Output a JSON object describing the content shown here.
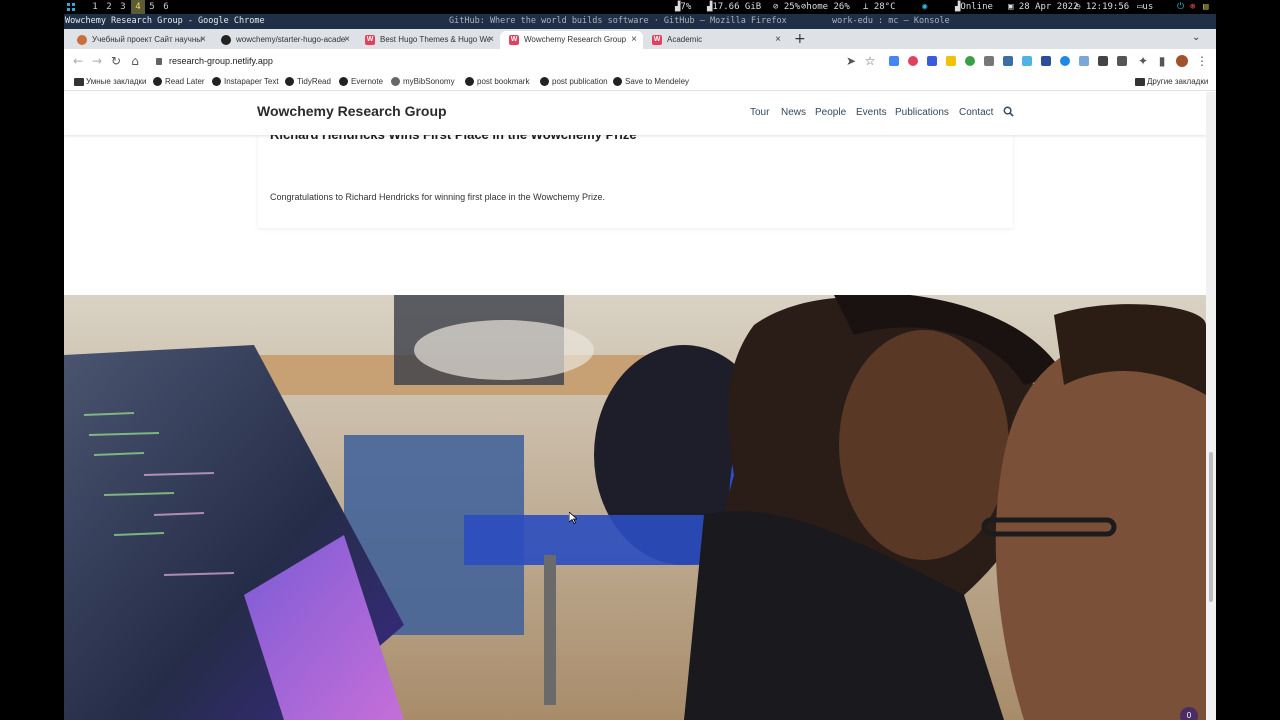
{
  "system_panel": {
    "workspaces": [
      "1",
      "2",
      "3",
      "4",
      "5",
      "6"
    ],
    "active_workspace": "4",
    "cpu": "7%",
    "memory": "17.66 GiB",
    "disk": "25%",
    "home": "home 26%",
    "temperature": "28°C",
    "network": "Online",
    "date": "28 Apr 2022",
    "time": "12:19:56",
    "keyboard": "us"
  },
  "window_titles": {
    "active": "Wowchemy Research Group - Google Chrome",
    "middle": "GitHub: Where the world builds software · GitHub — Mozilla Firefox",
    "right": "work-edu : mc — Konsole"
  },
  "tabs": [
    {
      "label": "Учебный проект Сайт научных",
      "icon": "graduation-icon"
    },
    {
      "label": "wowchemy/starter-hugo-academic",
      "icon": "github-icon"
    },
    {
      "label": "Best Hugo Themes & Hugo Websites",
      "icon": "wowchemy-icon"
    },
    {
      "label": "Wowchemy Research Group",
      "icon": "wowchemy-icon",
      "active": true
    },
    {
      "label": "Academic",
      "icon": "wowchemy-icon"
    }
  ],
  "address_bar": {
    "url": "research-group.netlify.app"
  },
  "bookmarks": [
    {
      "label": "Умные закладки",
      "icon": "folder-icon"
    },
    {
      "label": "Read Later",
      "icon": "globe-icon"
    },
    {
      "label": "Instapaper Text",
      "icon": "globe-icon"
    },
    {
      "label": "TidyRead",
      "icon": "globe-icon"
    },
    {
      "label": "Evernote",
      "icon": "globe-icon"
    },
    {
      "label": "myBibSonomy",
      "icon": "bibsonomy-icon"
    },
    {
      "label": "post bookmark",
      "icon": "globe-icon"
    },
    {
      "label": "post publication",
      "icon": "globe-icon"
    },
    {
      "label": "Save to Mendeley",
      "icon": "globe-icon"
    }
  ],
  "other_bookmarks": "Другие закладки",
  "site": {
    "brand": "Wowchemy Research Group",
    "menu": [
      "Tour",
      "News",
      "People",
      "Events",
      "Publications",
      "Contact"
    ]
  },
  "news_card": {
    "title": "Richard Hendricks Wins First Place in the Wowchemy Prize",
    "body": "Congratulations to Richard Hendricks for winning first place in the Wowchemy Prize."
  },
  "chat_badge": "0",
  "colors": {
    "accent": "#1565c0",
    "brand_badge": "#e0415c",
    "chat_badge": "#4a2d63"
  }
}
